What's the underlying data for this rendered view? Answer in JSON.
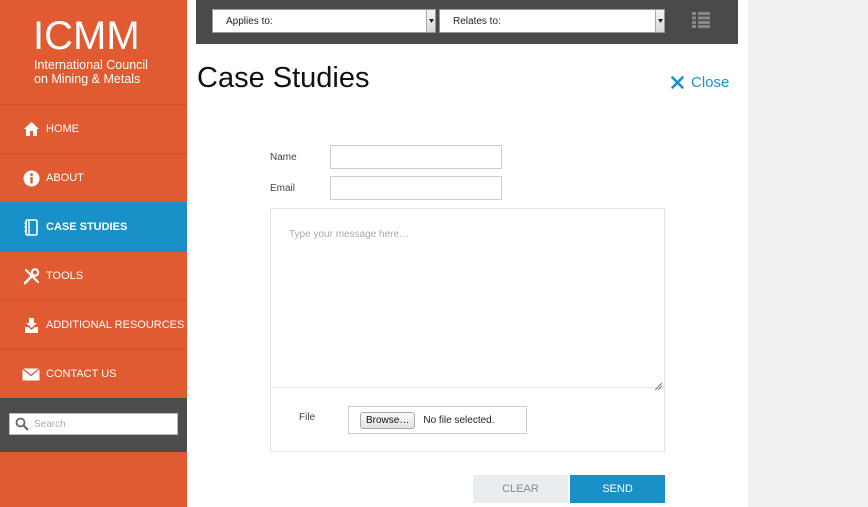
{
  "brand": {
    "logo_text": "ICMM",
    "subtitle_line1": "International Council",
    "subtitle_line2": "on Mining & Metals",
    "primary_color": "#e05a32",
    "accent_color": "#1a90c8"
  },
  "sidebar": {
    "items": [
      {
        "label": "HOME",
        "icon": "home-icon",
        "active": false
      },
      {
        "label": "ABOUT",
        "icon": "info-icon",
        "active": false
      },
      {
        "label": "CASE STUDIES",
        "icon": "book-icon",
        "active": true
      },
      {
        "label": "TOOLS",
        "icon": "tools-icon",
        "active": false
      },
      {
        "label": "ADDITIONAL RESOURCES",
        "icon": "download-icon",
        "active": false
      },
      {
        "label": "CONTACT US",
        "icon": "envelope-icon",
        "active": false
      }
    ],
    "search": {
      "placeholder": "Search"
    }
  },
  "topbar": {
    "applies_to": "Applies to:",
    "relates_to": "Relates to:"
  },
  "page": {
    "title": "Case Studies",
    "close_label": "Close"
  },
  "form": {
    "name_label": "Name",
    "name_value": "",
    "email_label": "Email",
    "email_value": "",
    "message_placeholder": "Type your message here…",
    "file_label": "File",
    "browse_label": "Browse…",
    "file_status": "No file selected.",
    "clear_label": "CLEAR",
    "send_label": "SEND"
  }
}
